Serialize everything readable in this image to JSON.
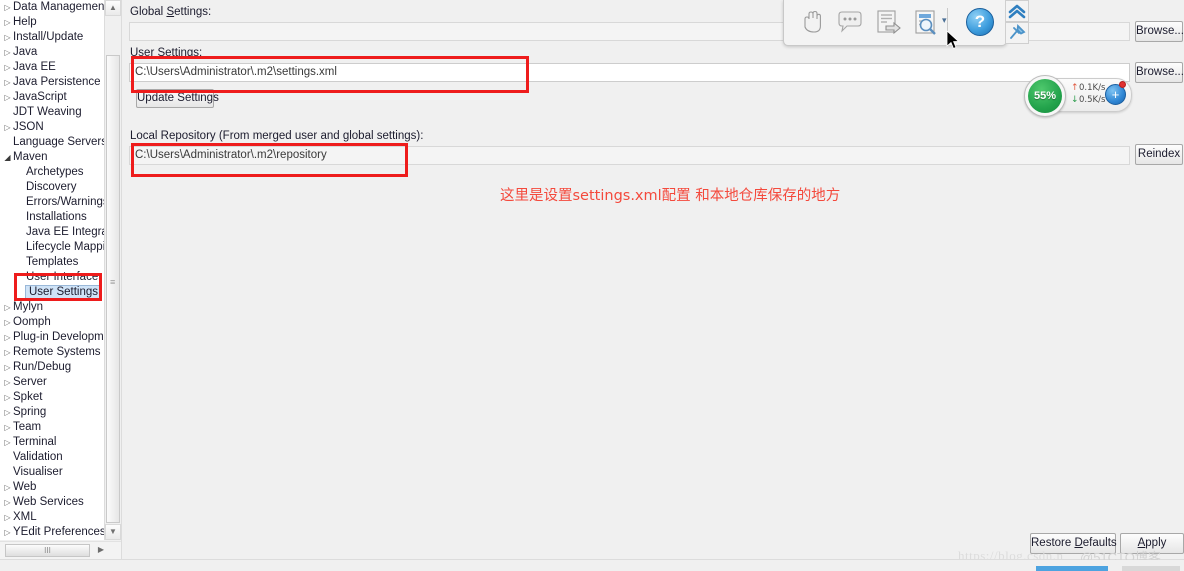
{
  "tree": {
    "items": [
      {
        "label": "Data Management",
        "level": 1,
        "arrow": "collapsed"
      },
      {
        "label": "Help",
        "level": 1,
        "arrow": "collapsed"
      },
      {
        "label": "Install/Update",
        "level": 1,
        "arrow": "collapsed"
      },
      {
        "label": "Java",
        "level": 1,
        "arrow": "collapsed"
      },
      {
        "label": "Java EE",
        "level": 1,
        "arrow": "collapsed"
      },
      {
        "label": "Java Persistence",
        "level": 1,
        "arrow": "collapsed"
      },
      {
        "label": "JavaScript",
        "level": 1,
        "arrow": "collapsed"
      },
      {
        "label": "JDT Weaving",
        "level": 1,
        "arrow": "none"
      },
      {
        "label": "JSON",
        "level": 1,
        "arrow": "collapsed"
      },
      {
        "label": "Language Servers",
        "level": 1,
        "arrow": "none"
      },
      {
        "label": "Maven",
        "level": 1,
        "arrow": "expanded"
      },
      {
        "label": "Archetypes",
        "level": 2,
        "arrow": "none"
      },
      {
        "label": "Discovery",
        "level": 2,
        "arrow": "none"
      },
      {
        "label": "Errors/Warnings",
        "level": 2,
        "arrow": "none"
      },
      {
        "label": "Installations",
        "level": 2,
        "arrow": "none"
      },
      {
        "label": "Java EE Integration",
        "level": 2,
        "arrow": "none"
      },
      {
        "label": "Lifecycle Mapping",
        "level": 2,
        "arrow": "none"
      },
      {
        "label": "Templates",
        "level": 2,
        "arrow": "none"
      },
      {
        "label": "User Interface",
        "level": 2,
        "arrow": "none"
      },
      {
        "label": "User Settings",
        "level": 2,
        "arrow": "none",
        "selected": true
      },
      {
        "label": "Mylyn",
        "level": 1,
        "arrow": "collapsed"
      },
      {
        "label": "Oomph",
        "level": 1,
        "arrow": "collapsed"
      },
      {
        "label": "Plug-in Development",
        "level": 1,
        "arrow": "collapsed"
      },
      {
        "label": "Remote Systems",
        "level": 1,
        "arrow": "collapsed"
      },
      {
        "label": "Run/Debug",
        "level": 1,
        "arrow": "collapsed"
      },
      {
        "label": "Server",
        "level": 1,
        "arrow": "collapsed"
      },
      {
        "label": "Spket",
        "level": 1,
        "arrow": "collapsed"
      },
      {
        "label": "Spring",
        "level": 1,
        "arrow": "collapsed"
      },
      {
        "label": "Team",
        "level": 1,
        "arrow": "collapsed"
      },
      {
        "label": "Terminal",
        "level": 1,
        "arrow": "collapsed"
      },
      {
        "label": "Validation",
        "level": 1,
        "arrow": "none"
      },
      {
        "label": "Visualiser",
        "level": 1,
        "arrow": "none"
      },
      {
        "label": "Web",
        "level": 1,
        "arrow": "collapsed"
      },
      {
        "label": "Web Services",
        "level": 1,
        "arrow": "collapsed"
      },
      {
        "label": "XML",
        "level": 1,
        "arrow": "collapsed"
      },
      {
        "label": "YEdit Preferences",
        "level": 1,
        "arrow": "collapsed"
      }
    ],
    "scroll_up_glyph": "▲",
    "scroll_down_glyph": "▼",
    "hscroll_grip": "III",
    "hscroll_right_glyph": "▶"
  },
  "pane": {
    "global_settings_label": "Global Settings:",
    "global_settings_mnemonic": "S",
    "global_settings_value": "",
    "global_settings_browse": "Browse...",
    "user_settings_label": "User Settings:",
    "user_settings_mnemonic": "S",
    "user_settings_value": "C:\\Users\\Administrator\\.m2\\settings.xml",
    "user_settings_browse": "Browse...",
    "update_settings_button": "Update Settings",
    "local_repository_label": "Local Repository (From merged user and global settings):",
    "local_repository_value": "C:\\Users\\Administrator\\.m2\\repository",
    "reindex_button": "Reindex",
    "annotation_text": "这里是设置settings.xml配置  和本地仓库保存的地方",
    "annotation_color": "#f4493c"
  },
  "toolbar": {
    "icons": [
      {
        "name": "hand-icon"
      },
      {
        "name": "comment-icon"
      },
      {
        "name": "document-export-icon"
      },
      {
        "name": "document-search-icon"
      }
    ],
    "dropdown_glyph": "▾",
    "help_glyph": "?",
    "collapse_glyph": "⌃⌃",
    "pin_glyph": "pin"
  },
  "net_widget": {
    "percent": "55%",
    "upload": "0.1K/s",
    "download": "0.5K/s",
    "up_arrow": "↑",
    "down_arrow": "↓",
    "plus_glyph": "+",
    "disc_color": "#23a34c"
  },
  "footer": {
    "restore_defaults": "Restore Defaults",
    "restore_defaults_mnemonic": "D",
    "apply": "Apply",
    "apply_mnemonic": "A",
    "watermark": "https://blog.csdn.n",
    "watermark_overlay": "@51CTO博客"
  }
}
